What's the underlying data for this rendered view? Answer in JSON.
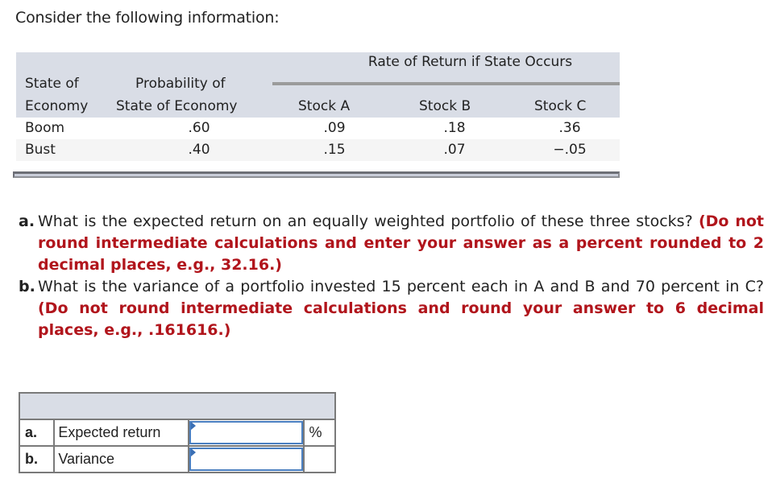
{
  "intro": "Consider the following information:",
  "info_table": {
    "group_header": "Rate of Return if State Occurs",
    "col_state_line1": "State of",
    "col_state_line2": "Economy",
    "col_prob_line1": "Probability of",
    "col_prob_line2": "State of Economy",
    "col_a": "Stock A",
    "col_b": "Stock B",
    "col_c": "Stock C",
    "rows": [
      {
        "state": "Boom",
        "prob": ".60",
        "a": ".09",
        "b": ".18",
        "c": ".36"
      },
      {
        "state": "Bust",
        "prob": ".40",
        "a": ".15",
        "b": ".07",
        "c": "−.05"
      }
    ]
  },
  "questions": {
    "a": {
      "label": "a.",
      "text": "What is the expected return on an equally weighted portfolio of these three stocks?",
      "instruction": "(Do not round intermediate calculations and enter your answer as a percent rounded to 2 decimal places, e.g., 32.16.)"
    },
    "b": {
      "label": "b.",
      "text": "What is the variance of a portfolio invested 15 percent each in A and B and 70 percent in C?",
      "instruction": "(Do not round intermediate calculations and round your answer to 6 decimal places, e.g., .161616.)"
    }
  },
  "answer_table": {
    "rows": [
      {
        "label": "a.",
        "text": "Expected return",
        "value": "",
        "unit": "%"
      },
      {
        "label": "b.",
        "text": "Variance",
        "value": "",
        "unit": ""
      }
    ]
  }
}
